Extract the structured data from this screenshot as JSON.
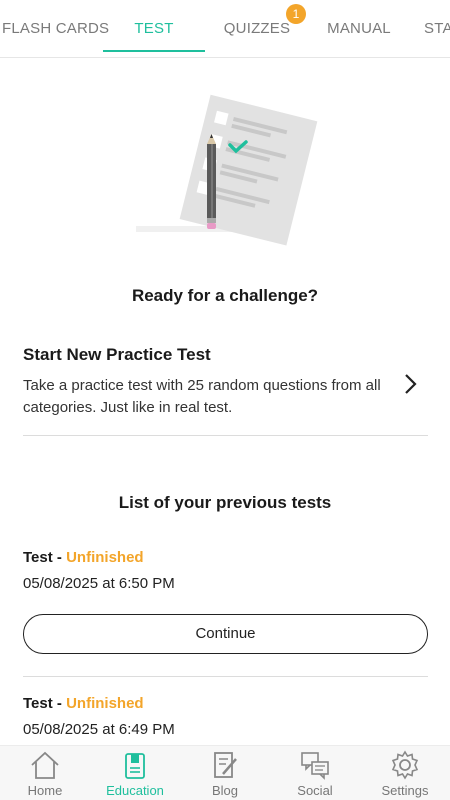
{
  "tabs": [
    {
      "label": "FLASH CARDS"
    },
    {
      "label": "TEST"
    },
    {
      "label": "QUIZZES",
      "badge": "1"
    },
    {
      "label": "MANUAL"
    },
    {
      "label": "STATS"
    }
  ],
  "main": {
    "challenge_heading": "Ready for a challenge?",
    "practice": {
      "title": "Start New Practice Test",
      "description": "Take a practice test with 25 random questions from all categories. Just like in real test."
    },
    "previous_heading": "List of your previous tests",
    "tests": [
      {
        "label": "Test",
        "separator": " - ",
        "status": "Unfinished",
        "date": "05/08/2025 at 6:50 PM",
        "button": "Continue"
      },
      {
        "label": "Test",
        "separator": " - ",
        "status": "Unfinished",
        "date": "05/08/2025 at 6:49 PM"
      }
    ]
  },
  "bottom_nav": [
    {
      "label": "Home",
      "icon": "home-icon"
    },
    {
      "label": "Education",
      "icon": "education-icon"
    },
    {
      "label": "Blog",
      "icon": "blog-icon"
    },
    {
      "label": "Social",
      "icon": "social-icon"
    },
    {
      "label": "Settings",
      "icon": "settings-icon"
    }
  ],
  "colors": {
    "accent": "#1fbf9d",
    "status_unfinished": "#f3a52a",
    "badge": "#f3a52a"
  }
}
